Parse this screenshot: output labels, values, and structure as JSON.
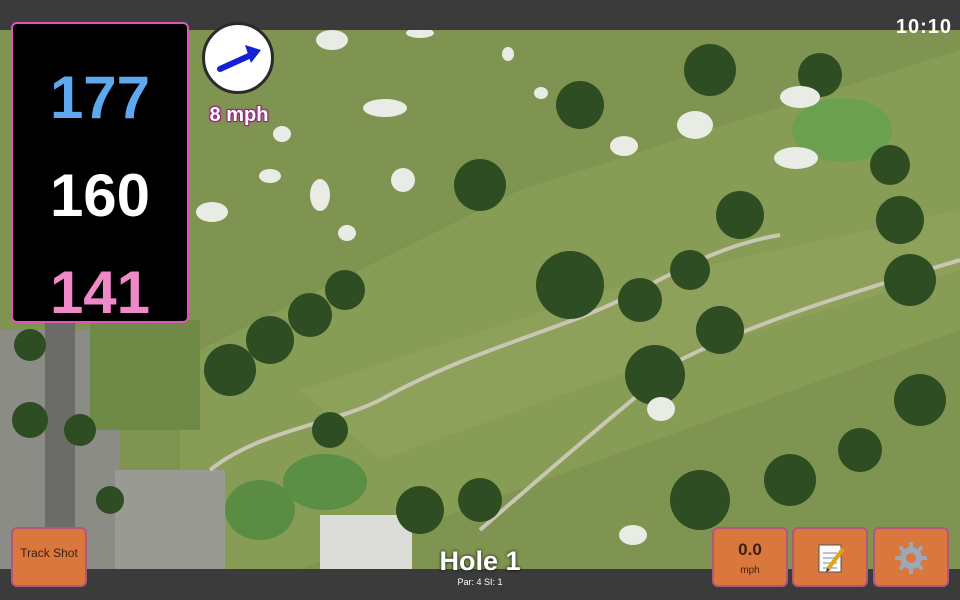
{
  "status": {
    "time": "10:10"
  },
  "distances": {
    "back": "177",
    "middle": "160",
    "front": "141",
    "colors": {
      "back": "#5ea8ee",
      "middle": "#ffffff",
      "front": "#f089c8"
    }
  },
  "wind": {
    "speed": "8 mph",
    "arrow_icon": "wind-direction-arrow"
  },
  "buttons": {
    "track_shot": "Track Shot",
    "speed_value": "0.0",
    "speed_unit": "mph",
    "notes_icon": "notepad-icon",
    "settings_icon": "gear-icon"
  },
  "hole": {
    "title": "Hole 1",
    "meta": "Par: 4   SI: 1"
  },
  "theme": {
    "button": "#d9773d",
    "panel_border": "#e056b6",
    "fairway": "#7e9a52",
    "bunker": "#e9ece4"
  }
}
